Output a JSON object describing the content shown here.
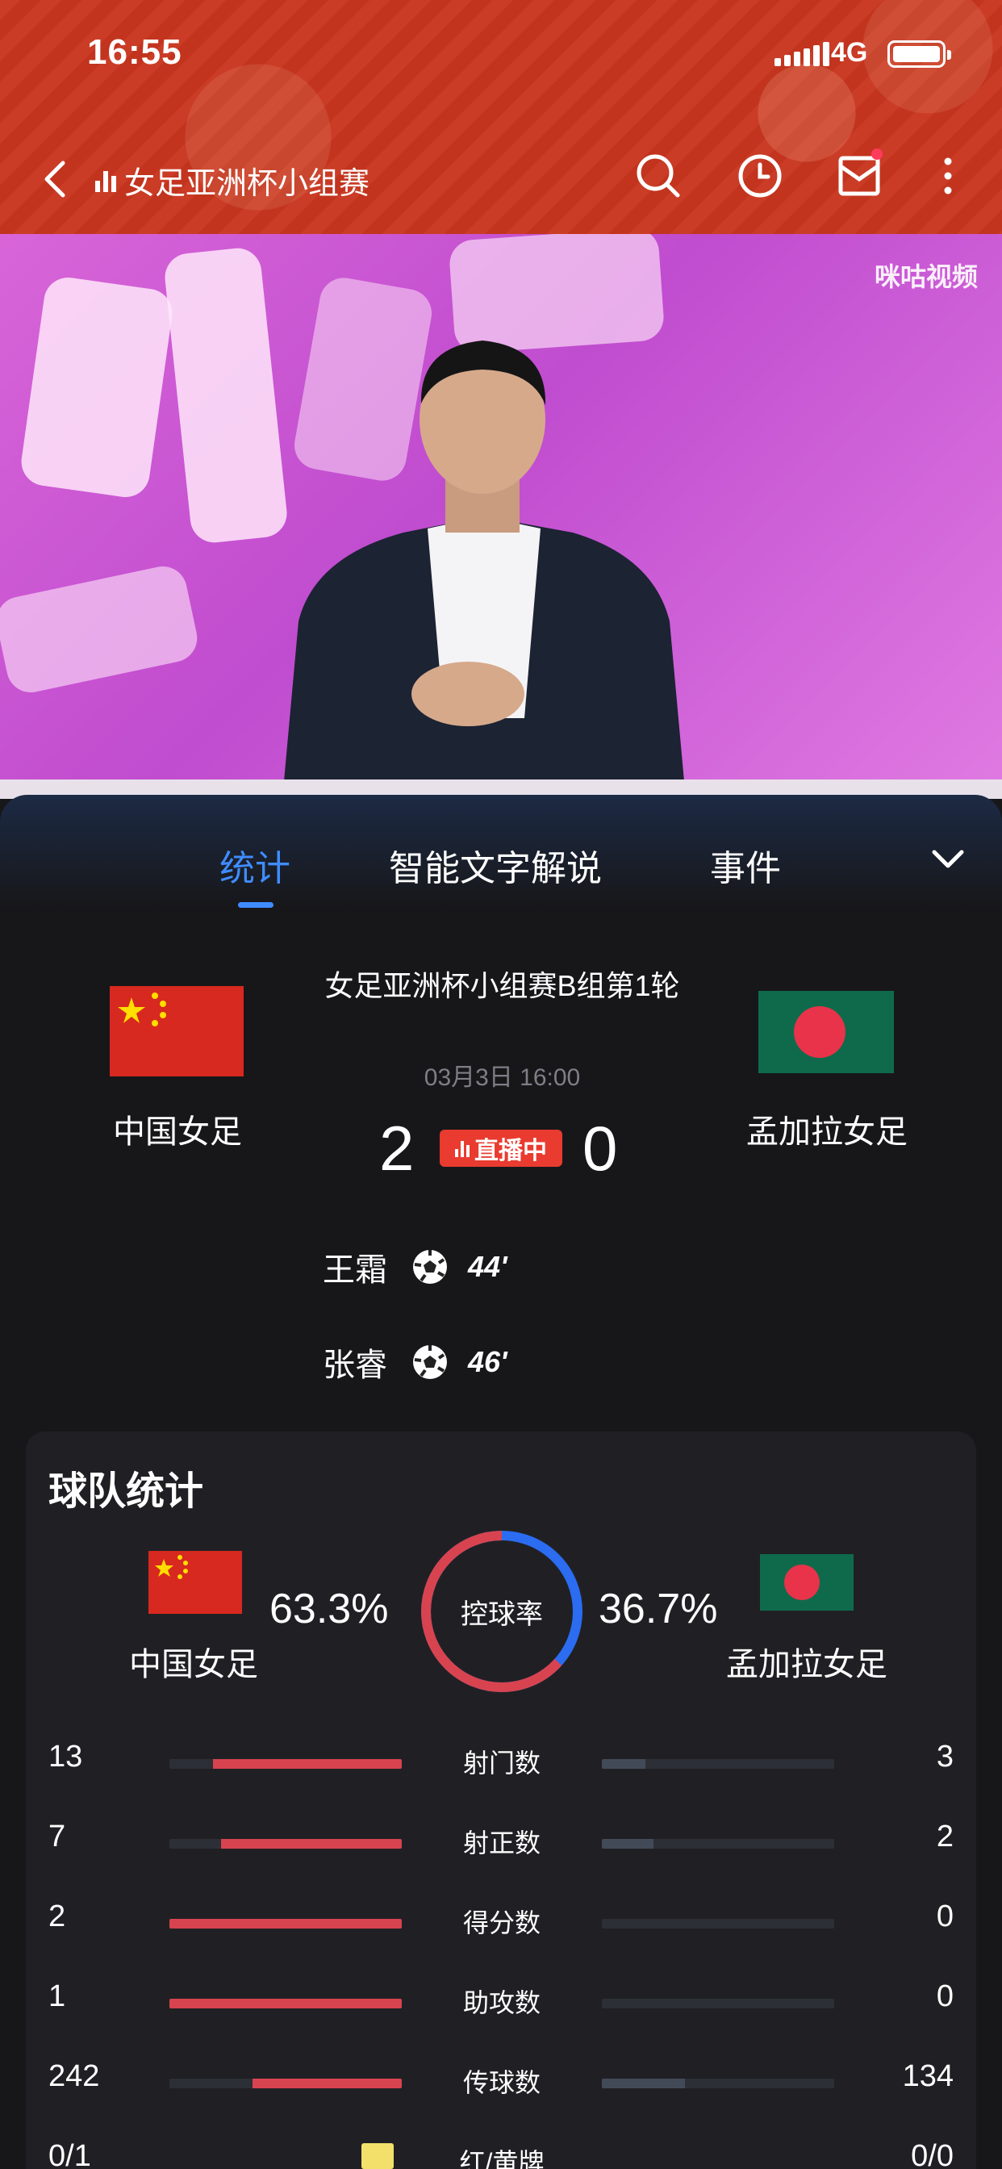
{
  "status_bar": {
    "time": "16:55",
    "network": "4G",
    "battery_level": 1.0
  },
  "header": {
    "title": "女足亚洲杯小组赛",
    "icons": [
      "back-icon",
      "chart-icon",
      "search-icon",
      "history-icon",
      "mail-icon",
      "more-icon"
    ],
    "has_unread_mail": true
  },
  "video": {
    "watermark": "咪咕视频"
  },
  "tabs": [
    {
      "label": "统计",
      "active": true
    },
    {
      "label": "智能文字解说",
      "active": false
    },
    {
      "label": "事件",
      "active": false
    }
  ],
  "match": {
    "title": "女足亚洲杯小组赛B组第1轮",
    "datetime": "03月3日 16:00",
    "home": {
      "name": "中国女足",
      "score": "2",
      "flag": "china"
    },
    "away": {
      "name": "孟加拉女足",
      "score": "0",
      "flag": "bangladesh"
    },
    "live_label": "直播中",
    "scorers": [
      {
        "name": "王霜",
        "minute": "44'"
      },
      {
        "name": "张睿",
        "minute": "46'"
      }
    ]
  },
  "team_stats": {
    "title": "球队统计",
    "possession": {
      "label": "控球率",
      "home": "63.3%",
      "away": "36.7%",
      "home_fraction": 0.633
    },
    "rows": [
      {
        "label": "射门数",
        "home": "13",
        "away": "3",
        "home_v": 13,
        "away_v": 3
      },
      {
        "label": "射正数",
        "home": "7",
        "away": "2",
        "home_v": 7,
        "away_v": 2
      },
      {
        "label": "得分数",
        "home": "2",
        "away": "0",
        "home_v": 2,
        "away_v": 0
      },
      {
        "label": "助攻数",
        "home": "1",
        "away": "0",
        "home_v": 1,
        "away_v": 0
      },
      {
        "label": "传球数",
        "home": "242",
        "away": "134",
        "home_v": 242,
        "away_v": 134
      },
      {
        "label": "红/黄牌",
        "home": "0/1",
        "away": "0/0"
      }
    ]
  },
  "colors": {
    "header_red": "#c8361f",
    "accent_blue": "#3f8cff",
    "bar_red": "#d84350",
    "live_red": "#e93b2f"
  }
}
